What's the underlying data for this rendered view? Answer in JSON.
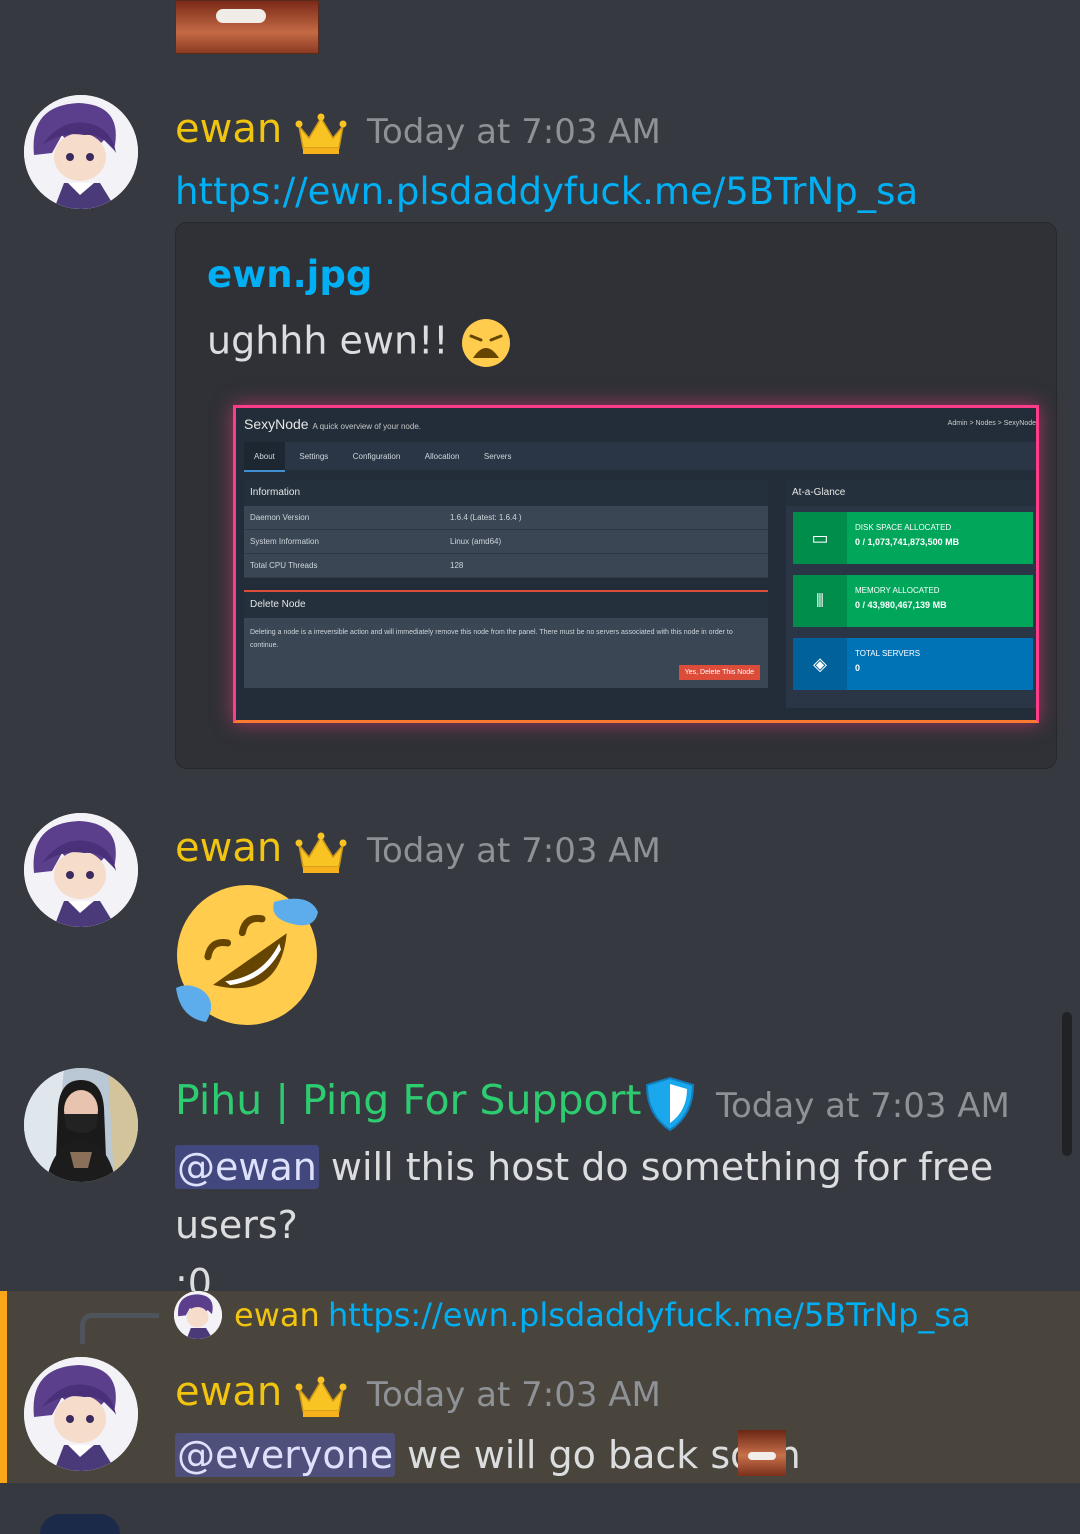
{
  "messages": [
    {
      "username": "ewan",
      "timestamp": "Today at 7:03 AM",
      "link": "https://ewn.plsdaddyfuck.me/5BTrNp_sa",
      "embed": {
        "title": "ewn.jpg",
        "description": "ughhh ewn!!",
        "screenshot": {
          "node_name": "SexyNode",
          "node_subtitle": "A quick overview of your node.",
          "breadcrumb": "Admin  >  Nodes  >  SexyNode",
          "tabs": [
            "About",
            "Settings",
            "Configuration",
            "Allocation",
            "Servers"
          ],
          "info_title": "Information",
          "info_rows": [
            {
              "label": "Daemon Version",
              "value": "1.6.4 (Latest: 1.6.4 )"
            },
            {
              "label": "System Information",
              "value": "Linux (amd64)"
            },
            {
              "label": "Total CPU Threads",
              "value": "128"
            }
          ],
          "delete_title": "Delete Node",
          "delete_text": "Deleting a node is a irreversible action and will immediately remove this node from the panel. There must be no servers associated with this node in order to continue.",
          "delete_button": "Yes, Delete This Node",
          "glance_title": "At-a-Glance",
          "tiles": [
            {
              "label": "DISK SPACE ALLOCATED",
              "value": "0 / 1,073,741,873,500 MB",
              "color": "#00a65a"
            },
            {
              "label": "MEMORY ALLOCATED",
              "value": "0 / 43,980,467,139 MB",
              "color": "#00a65a"
            },
            {
              "label": "TOTAL SERVERS",
              "value": "0",
              "color": "#0073b7"
            }
          ]
        }
      }
    },
    {
      "username": "ewan",
      "timestamp": "Today at 7:03 AM",
      "emoji": "rolling-on-floor-laughing"
    },
    {
      "username": "Pihu | Ping For Support",
      "username_color": "#2ecc71",
      "timestamp": "Today at 7:03 AM",
      "mention": "@ewan",
      "text": " will this host do something for free users?",
      "text2": ":0"
    },
    {
      "reply": {
        "username": "ewan",
        "text": "https://ewn.plsdaddyfuck.me/5BTrNp_sa"
      },
      "username": "ewan",
      "timestamp": "Today at 7:03 AM",
      "mention": "@everyone",
      "text": " we will go back soon"
    }
  ],
  "colors": {
    "background": "#36393f",
    "owner_name": "#f1c40f",
    "link": "#00aff4",
    "mention_highlight_bg": "#49443c",
    "mention_bar": "#faa61a"
  }
}
